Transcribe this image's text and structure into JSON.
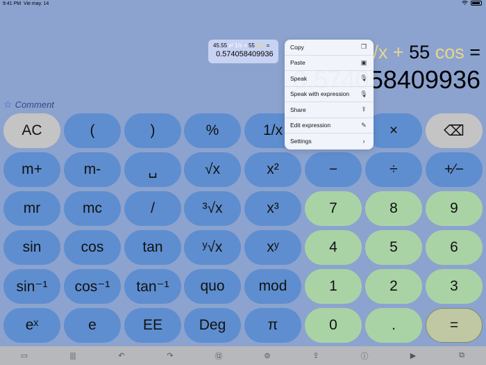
{
  "status": {
    "time": "9:41 PM",
    "date": "Vie may. 14",
    "battery": "100%"
  },
  "display": {
    "expr_visible": [
      {
        "t": "/x",
        "cls": "op"
      },
      {
        "t": " + ",
        "cls": "op"
      },
      {
        "t": "55 ",
        "cls": ""
      },
      {
        "t": "cos",
        "cls": "fn"
      },
      {
        "t": " =",
        "cls": ""
      }
    ],
    "result_visible": "0.574058409936",
    "comment_placeholder": "Comment"
  },
  "history_popup": {
    "line1_parts": [
      {
        "t": "45.55 ",
        "cls": ""
      },
      {
        "t": "x² 1/x + ",
        "cls": "op"
      },
      {
        "t": "55 ",
        "cls": ""
      },
      {
        "t": "cos",
        "cls": "fn"
      },
      {
        "t": " =",
        "cls": ""
      }
    ],
    "line2": "0.574058409936"
  },
  "context_menu": [
    {
      "label": "Copy",
      "icon": "copy-icon"
    },
    {
      "label": "Paste",
      "icon": "paste-icon"
    },
    {
      "label": "Speak",
      "icon": "microphone-icon"
    },
    {
      "label": "Speak with expression",
      "icon": "microphone-icon"
    },
    {
      "label": "Share",
      "icon": "share-icon"
    },
    {
      "label": "Edit expression",
      "icon": "pencil-icon"
    },
    {
      "label": "Settings",
      "icon": "chevron-right-icon"
    }
  ],
  "keys": [
    {
      "label": "AC",
      "style": "gray",
      "name": "all-clear-button"
    },
    {
      "label": "(",
      "style": "blue",
      "name": "open-paren-button"
    },
    {
      "label": ")",
      "style": "blue",
      "name": "close-paren-button"
    },
    {
      "label": "%",
      "style": "blue",
      "name": "percent-button"
    },
    {
      "label": "1/x",
      "style": "blue",
      "name": "reciprocal-button"
    },
    {
      "label": "",
      "style": "blue",
      "name": "hidden-key"
    },
    {
      "label": "×",
      "style": "blue",
      "name": "multiply-button"
    },
    {
      "label": "⌫",
      "style": "gray",
      "name": "backspace-button"
    },
    {
      "label": "m+",
      "style": "blue",
      "name": "memory-plus-button"
    },
    {
      "label": "m-",
      "style": "blue",
      "name": "memory-minus-button"
    },
    {
      "label": "␣",
      "style": "blue",
      "name": "space-button"
    },
    {
      "label": "√x",
      "style": "blue",
      "name": "square-root-button"
    },
    {
      "label": "x²",
      "style": "blue",
      "name": "square-button"
    },
    {
      "label": "−",
      "style": "blue",
      "name": "minus-button"
    },
    {
      "label": "÷",
      "style": "blue",
      "name": "divide-button"
    },
    {
      "label": "+⁄−",
      "style": "blue",
      "name": "plus-minus-button"
    },
    {
      "label": "mr",
      "style": "blue",
      "name": "memory-recall-button"
    },
    {
      "label": "mc",
      "style": "blue",
      "name": "memory-clear-button"
    },
    {
      "label": "/",
      "style": "blue",
      "name": "fraction-button"
    },
    {
      "label": "³√x",
      "style": "blue",
      "name": "cube-root-button"
    },
    {
      "label": "x³",
      "style": "blue",
      "name": "cube-button"
    },
    {
      "label": "7",
      "style": "green",
      "name": "digit-7-button"
    },
    {
      "label": "8",
      "style": "green",
      "name": "digit-8-button"
    },
    {
      "label": "9",
      "style": "green",
      "name": "digit-9-button"
    },
    {
      "label": "sin",
      "style": "blue",
      "name": "sin-button"
    },
    {
      "label": "cos",
      "style": "blue",
      "name": "cos-button"
    },
    {
      "label": "tan",
      "style": "blue",
      "name": "tan-button"
    },
    {
      "label": "ʸ√x",
      "style": "blue",
      "name": "y-root-button"
    },
    {
      "label": "xʸ",
      "style": "blue",
      "name": "power-button"
    },
    {
      "label": "4",
      "style": "green",
      "name": "digit-4-button"
    },
    {
      "label": "5",
      "style": "green",
      "name": "digit-5-button"
    },
    {
      "label": "6",
      "style": "green",
      "name": "digit-6-button"
    },
    {
      "label": "sin⁻¹",
      "style": "blue",
      "name": "asin-button"
    },
    {
      "label": "cos⁻¹",
      "style": "blue",
      "name": "acos-button"
    },
    {
      "label": "tan⁻¹",
      "style": "blue",
      "name": "atan-button"
    },
    {
      "label": "quo",
      "style": "blue",
      "name": "quotient-button"
    },
    {
      "label": "mod",
      "style": "blue",
      "name": "modulo-button"
    },
    {
      "label": "1",
      "style": "green",
      "name": "digit-1-button"
    },
    {
      "label": "2",
      "style": "green",
      "name": "digit-2-button"
    },
    {
      "label": "3",
      "style": "green",
      "name": "digit-3-button"
    },
    {
      "label": "eˣ",
      "style": "blue",
      "name": "exp-button"
    },
    {
      "label": "e",
      "style": "blue",
      "name": "e-constant-button"
    },
    {
      "label": "EE",
      "style": "blue",
      "name": "exponent-entry-button"
    },
    {
      "label": "Deg",
      "style": "blue",
      "name": "angle-mode-button"
    },
    {
      "label": "π",
      "style": "blue",
      "name": "pi-button"
    },
    {
      "label": "0",
      "style": "green",
      "name": "digit-0-button"
    },
    {
      "label": ".",
      "style": "green",
      "name": "decimal-point-button"
    },
    {
      "label": "=",
      "style": "eq",
      "name": "equals-button"
    }
  ],
  "toolbar": [
    {
      "icon": "sidebar-icon",
      "glyph": "▭"
    },
    {
      "icon": "tape-icon",
      "glyph": "|||"
    },
    {
      "icon": "undo-icon",
      "glyph": "↶"
    },
    {
      "icon": "redo-icon",
      "glyph": "↷"
    },
    {
      "icon": "numbers-icon",
      "glyph": "⑫"
    },
    {
      "icon": "scientific-icon",
      "glyph": "⊜"
    },
    {
      "icon": "share-icon",
      "glyph": "⇪"
    },
    {
      "icon": "info-icon",
      "glyph": "ⓘ"
    },
    {
      "icon": "play-icon",
      "glyph": "▶"
    },
    {
      "icon": "new-window-icon",
      "glyph": "⧉"
    }
  ]
}
